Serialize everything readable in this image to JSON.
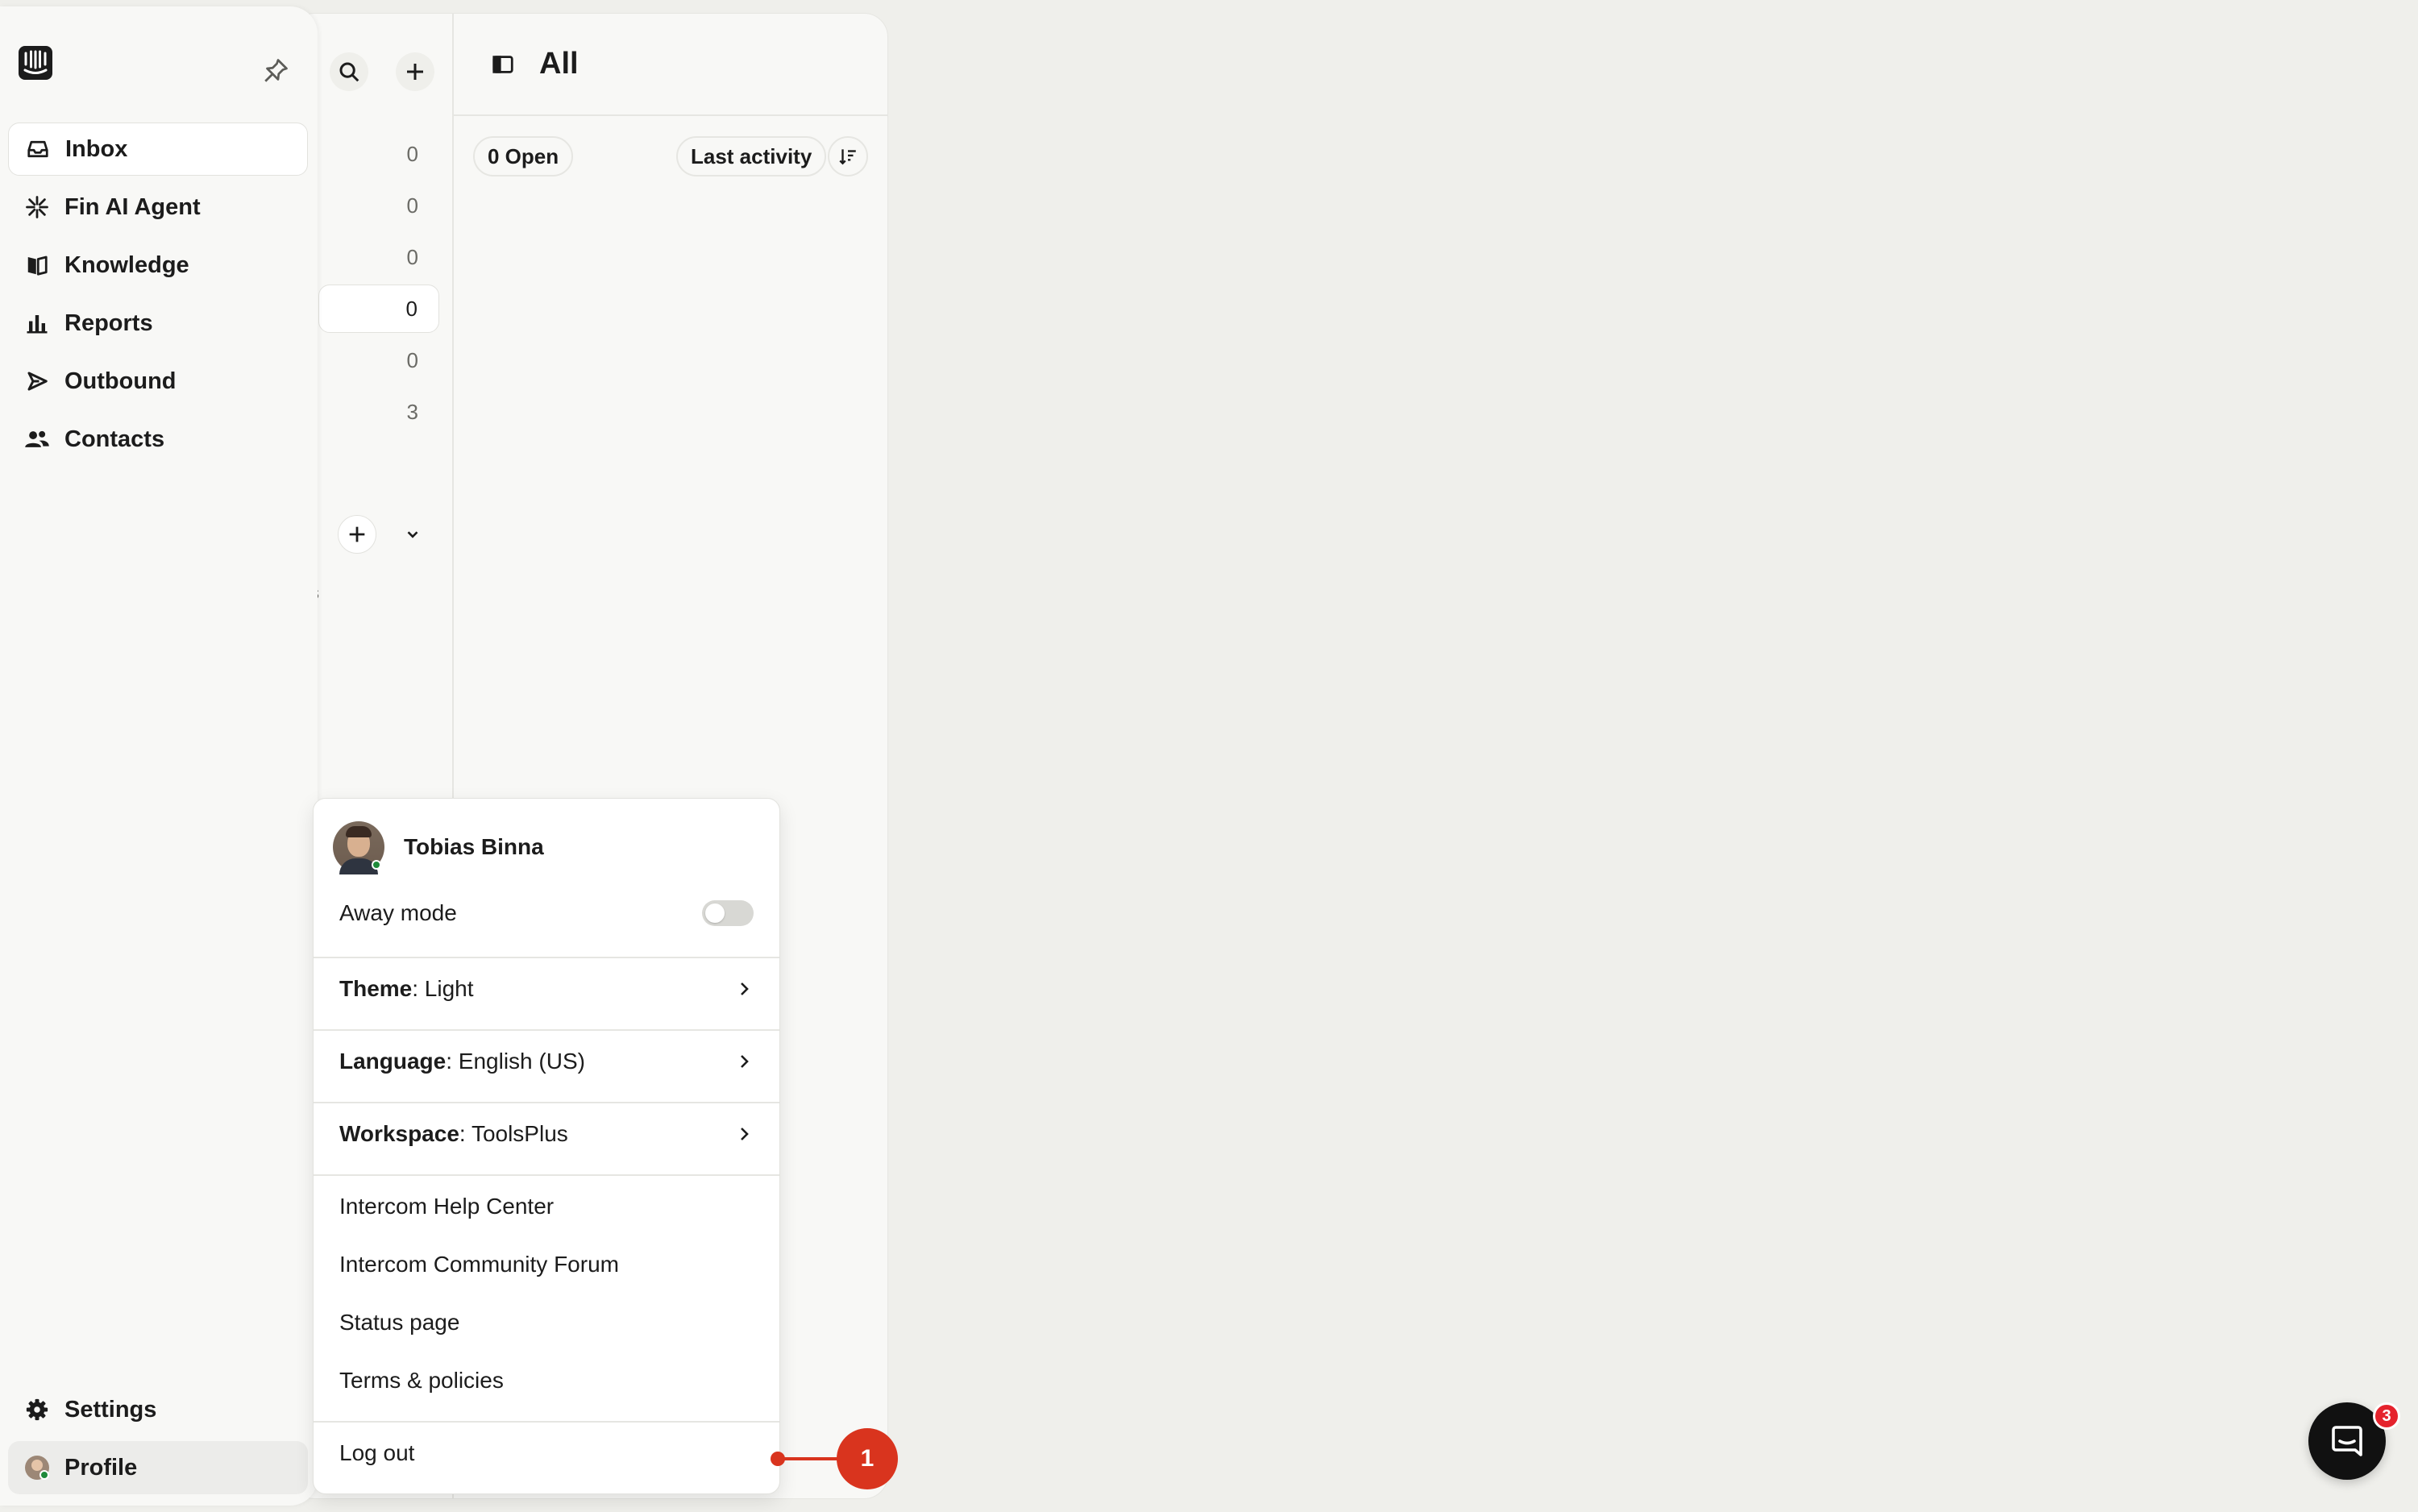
{
  "nav": {
    "items": [
      {
        "label": "Inbox",
        "icon": "inbox-icon",
        "active": true
      },
      {
        "label": "Fin AI Agent",
        "icon": "fin-icon"
      },
      {
        "label": "Knowledge",
        "icon": "book-icon"
      },
      {
        "label": "Reports",
        "icon": "bar-chart-icon"
      },
      {
        "label": "Outbound",
        "icon": "send-icon"
      },
      {
        "label": "Contacts",
        "icon": "people-icon"
      }
    ],
    "settings_label": "Settings",
    "profile_label": "Profile"
  },
  "inbox_list": {
    "counts": [
      "0",
      "0",
      "0",
      "0",
      "0",
      "3"
    ],
    "clipped_label": "s"
  },
  "conversations": {
    "title": "All",
    "open_filter": "0 Open",
    "sort_label": "Last activity"
  },
  "profile_menu": {
    "user_name": "Tobias Binna",
    "away_mode_label": "Away mode",
    "away_mode_on": false,
    "theme": {
      "key": "Theme",
      "value": ": Light"
    },
    "language": {
      "key": "Language",
      "value": ": English (US)"
    },
    "workspace": {
      "key": "Workspace",
      "value": ": ToolsPlus"
    },
    "links": [
      "Intercom Help Center",
      "Intercom Community Forum",
      "Status page",
      "Terms & policies"
    ],
    "logout_label": "Log out"
  },
  "step_marker": "1",
  "messenger": {
    "badge_count": "3"
  },
  "colors": {
    "accent_red": "#d9341e",
    "online_green": "#1f8a3a",
    "badge_red": "#e5232d"
  }
}
